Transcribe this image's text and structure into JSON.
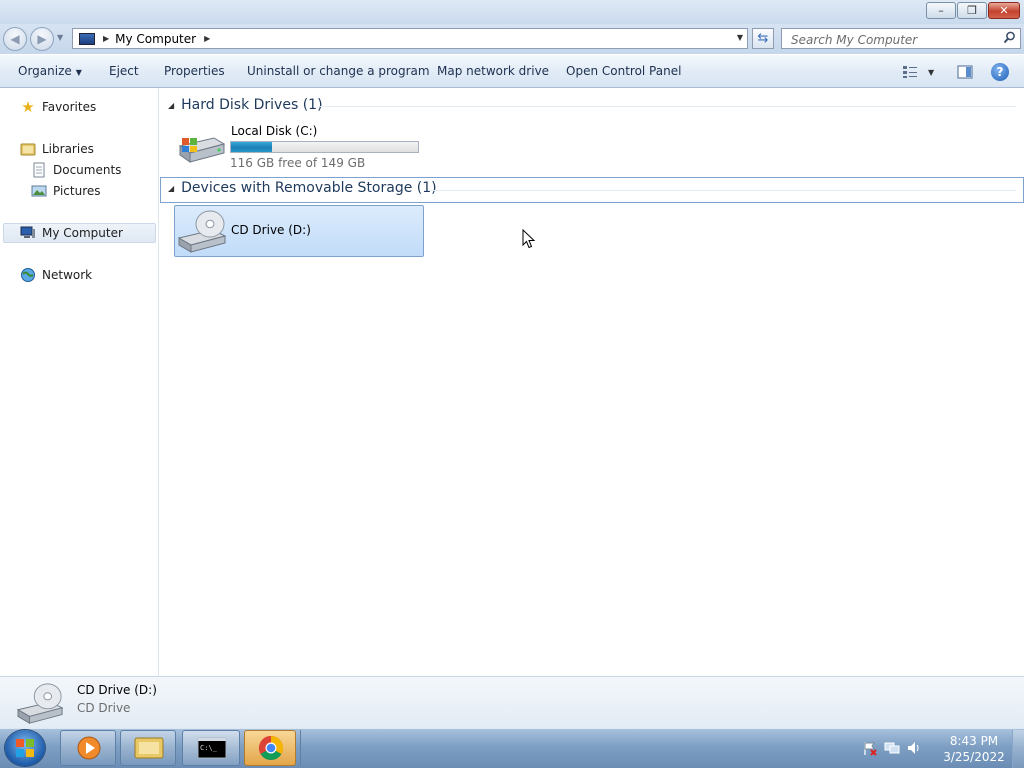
{
  "window": {
    "minimize_label": "–",
    "maximize_label": "❐",
    "close_label": "✕"
  },
  "address_bar": {
    "path": "My Computer",
    "search_placeholder": "Search My Computer"
  },
  "command_bar": {
    "organize": "Organize",
    "eject": "Eject",
    "properties": "Properties",
    "uninstall": "Uninstall or change a program",
    "map_drive": "Map network drive",
    "control_panel": "Open Control Panel",
    "help": "?"
  },
  "nav": {
    "favorites": "Favorites",
    "libraries": "Libraries",
    "documents": "Documents",
    "pictures": "Pictures",
    "my_computer": "My Computer",
    "network": "Network"
  },
  "content": {
    "group_hdd": "Hard Disk Drives (1)",
    "group_removable": "Devices with Removable Storage (1)",
    "drive_c": {
      "name": "Local Disk (C:)",
      "free_text": "116 GB free of 149 GB",
      "used_fraction": 0.22
    },
    "drive_d": {
      "name": "CD Drive (D:)"
    }
  },
  "details": {
    "name": "CD Drive (D:)",
    "type": "CD Drive"
  },
  "taskbar": {
    "time": "8:43 PM",
    "date": "3/25/2022"
  },
  "colors": {
    "accent": "#1e395b",
    "selection": "#c1dcf9",
    "bar_fill": "#1b7fb5"
  }
}
